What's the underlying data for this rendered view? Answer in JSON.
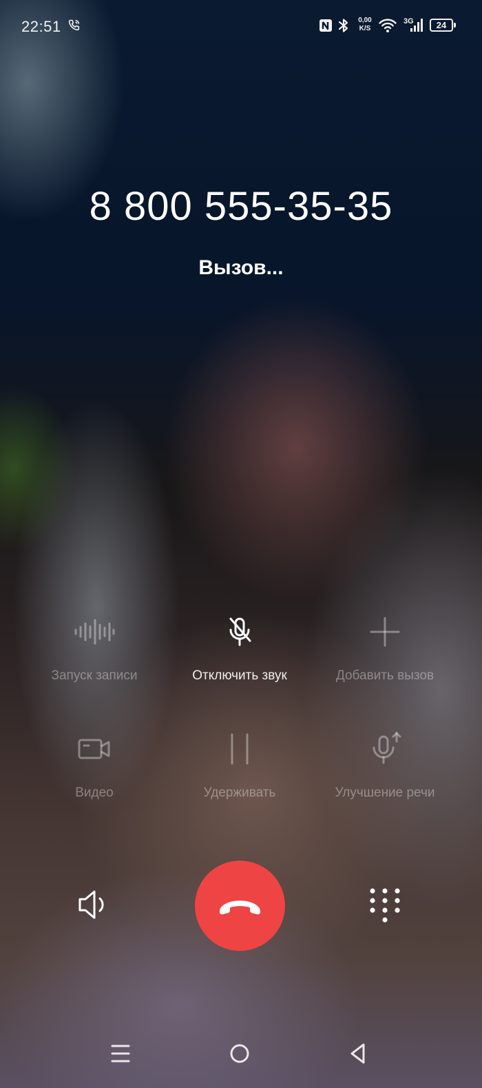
{
  "status_bar": {
    "time": "22:51",
    "net_speed_value": "0,00",
    "net_speed_unit": "K/S",
    "network_type": "3G",
    "battery_level": "24",
    "icons": [
      "call-active-icon",
      "nfc-icon",
      "bluetooth-icon",
      "wifi-icon",
      "signal-icon",
      "battery-icon"
    ]
  },
  "call": {
    "number": "8 800 555-35-35",
    "status": "Вызов..."
  },
  "controls": {
    "record_label": "Запуск записи",
    "mute_label": "Отключить звук",
    "add_call_label": "Добавить вызов",
    "video_label": "Видео",
    "hold_label": "Удерживать",
    "speech_enhance_label": "Улучшение речи"
  },
  "colors": {
    "end_call": "#ef4444",
    "active_control": "#ffffff",
    "dim_control": "rgba(255,255,255,0.36)"
  },
  "bottom_actions": [
    "speaker-icon",
    "end-call-icon",
    "dialpad-icon"
  ],
  "nav_bar": [
    "menu-icon",
    "home-icon",
    "back-icon"
  ]
}
